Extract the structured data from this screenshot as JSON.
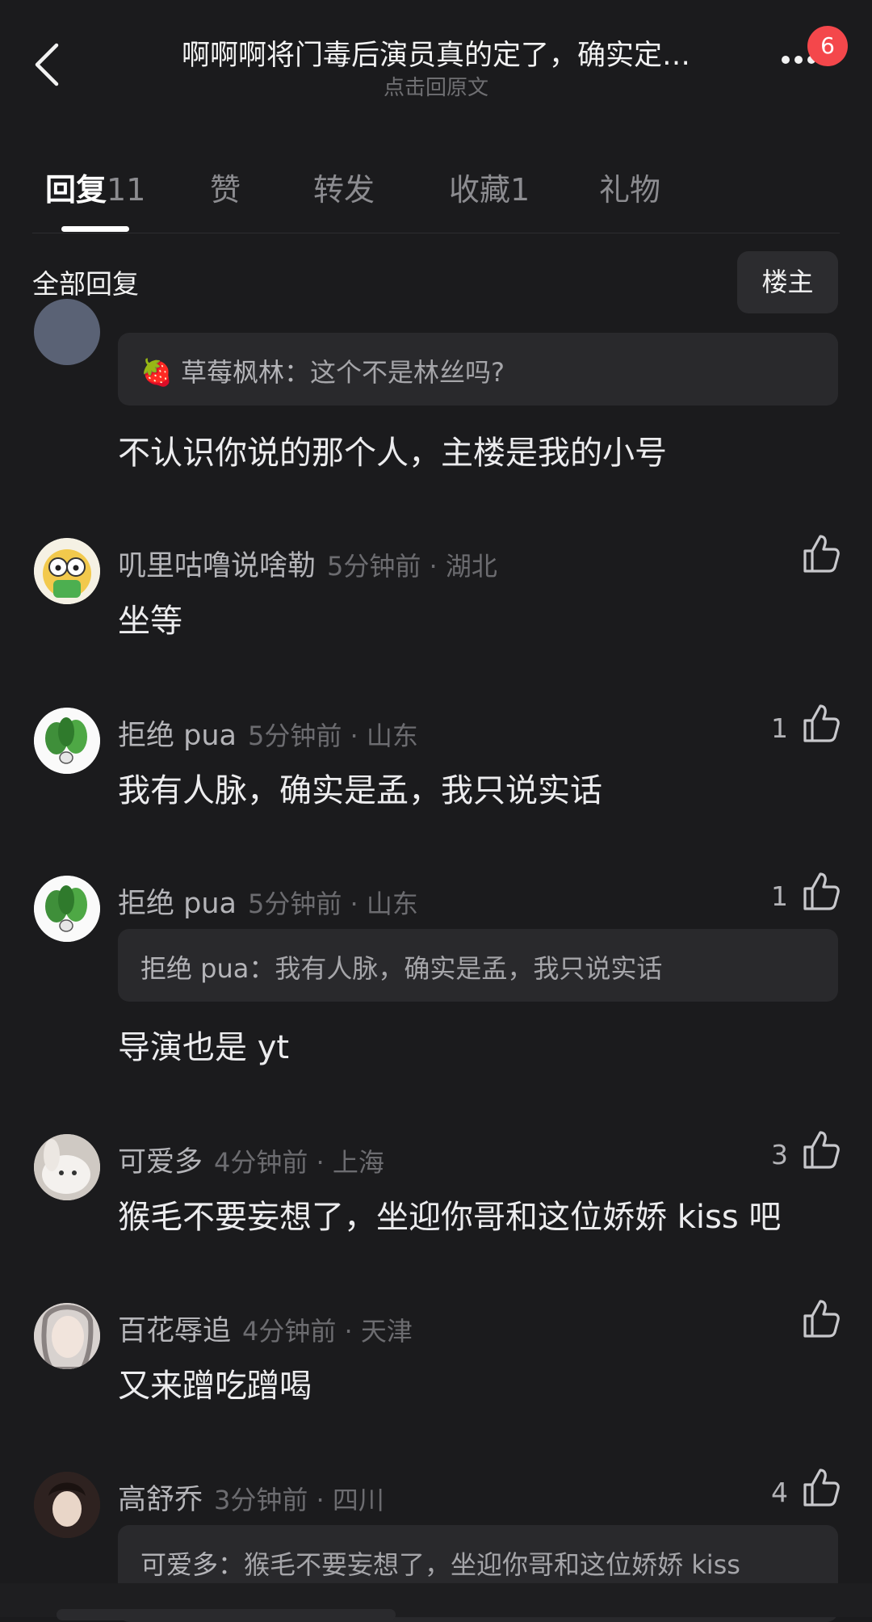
{
  "header": {
    "title": "啊啊啊将门毒后演员真的定了，确实定…",
    "subtitle": "点击回原文",
    "badge": "6"
  },
  "tabs": [
    {
      "label": "回复",
      "count": "11"
    },
    {
      "label": "赞",
      "count": ""
    },
    {
      "label": "转发",
      "count": ""
    },
    {
      "label": "收藏",
      "count": "1"
    },
    {
      "label": "礼物",
      "count": ""
    }
  ],
  "filter": {
    "all_label": "全部回复",
    "op_label": "楼主"
  },
  "comments": [
    {
      "quote_emoji": "🍓",
      "quote_name": "草莓枫林：",
      "quote_text": "这个不是林丝吗?",
      "text": "不认识你说的那个人，主楼是我的小号"
    },
    {
      "name": "叽里咕噜说啥勒",
      "time": "5分钟前 · 湖北",
      "likes": "",
      "text": "坐等"
    },
    {
      "name": "拒绝 pua",
      "time": "5分钟前 · 山东",
      "likes": "1",
      "text": "我有人脉，确实是孟，我只说实话"
    },
    {
      "name": "拒绝 pua",
      "time": "5分钟前 · 山东",
      "likes": "1",
      "quote_name": "拒绝 pua：",
      "quote_text": "我有人脉，确实是孟，我只说实话",
      "text": "导演也是 yt"
    },
    {
      "name": "可爱多",
      "time": "4分钟前 · 上海",
      "likes": "3",
      "text": "猴毛不要妄想了，坐迎你哥和这位娇娇 kiss 吧"
    },
    {
      "name": "百花辱追",
      "time": "4分钟前 · 天津",
      "likes": "",
      "text": "又来蹭吃蹭喝"
    },
    {
      "name": "高舒乔",
      "time": "3分钟前 · 四川",
      "likes": "4",
      "quote_name": "可爱多：",
      "quote_text": "猴毛不要妄想了，坐迎你哥和这位娇娇 kiss"
    }
  ],
  "colors": {
    "background": "#1b1b1d",
    "badge": "#f4474b",
    "quote_bg": "#29292c"
  }
}
